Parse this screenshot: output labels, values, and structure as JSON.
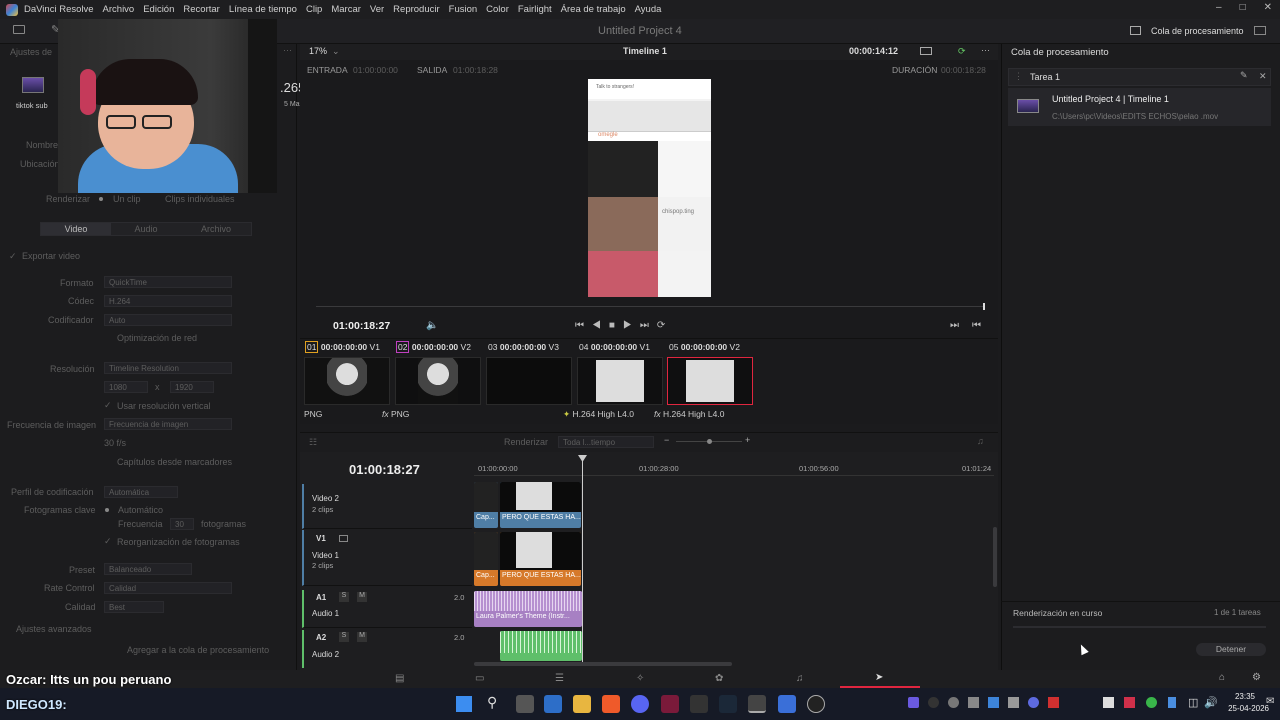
{
  "app": {
    "name": "DaVinci Resolve",
    "menu": [
      "Archivo",
      "Edición",
      "Recortar",
      "Línea de tiempo",
      "Clip",
      "Marcar",
      "Ver",
      "Reproducir",
      "Fusion",
      "Color",
      "Fairlight",
      "Área de trabajo",
      "Ayuda"
    ],
    "project_title": "Untitled Project 4",
    "timeline_name": "Timeline 1",
    "zoom": "17%",
    "timecode_top": "00:00:14:12",
    "render_queue_title": "Cola de procesamiento"
  },
  "left_panel": {
    "header": "Ajustes de",
    "preset_label": "tiktok sub",
    "codec_partial": ".265",
    "codec_partial2": "5 Mas",
    "nombre": "Nombre",
    "ubicacion": "Ubicación",
    "renderizar": "Renderizar",
    "un_clip": "Un clip",
    "clips_individuales": "Clips individuales",
    "tabs": [
      "Video",
      "Audio",
      "Archivo"
    ],
    "exportar_video": "Exportar video",
    "rows": [
      {
        "label": "Formato",
        "value": "QuickTime"
      },
      {
        "label": "Códec",
        "value": "H.264"
      },
      {
        "label": "Codificador",
        "value": "Auto"
      }
    ],
    "optimizacion": "Optimización de red",
    "resolucion_label": "Resolución",
    "resolucion_value": "Timeline Resolution",
    "res_w": "1080",
    "res_x": "x",
    "res_h": "1920",
    "usar_vertical": "Usar resolución vertical",
    "frecuencia_label": "Frecuencia de imagen",
    "frecuencia_value": "Frecuencia de imagen",
    "fps": "30 f/s",
    "capitulos": "Capítulos desde marcadores",
    "perfil_label": "Perfil de codificación",
    "perfil_value": "Automática",
    "fotogramas_label": "Fotogramas clave",
    "automatico": "Automático",
    "frecuencia": "Frecuencia",
    "frecuencia_num": "30",
    "fotogramas": "fotogramas",
    "reorganizacion": "Reorganización de fotogramas",
    "preset_row": {
      "label": "Preset",
      "value": "Balanceado"
    },
    "rate_row": {
      "label": "Rate Control",
      "value": "Calidad"
    },
    "calidad_row": {
      "label": "Calidad",
      "value": "Best"
    },
    "ajustes_avanzados": "Ajustes avanzados",
    "add_queue": "Agregar a la cola de procesamiento"
  },
  "viewer": {
    "entrada": "ENTRADA",
    "entrada_tc": "01:00:00:00",
    "salida": "SALIDA",
    "salida_tc": "01:00:18:28",
    "duracion": "DURACIÓN",
    "duracion_tc": "00:00:18:28",
    "current_tc": "01:00:18:27",
    "preview_text1": "Talk to strangers!",
    "preview_text2": "omegle",
    "preview_text3": "chispop.ting"
  },
  "clips": [
    {
      "num": "01",
      "tc": "00:00:00:00",
      "track": "V1",
      "label": "PNG",
      "fx": false
    },
    {
      "num": "02",
      "tc": "00:00:00:00",
      "track": "V2",
      "label": "PNG",
      "fx": true
    },
    {
      "num": "03",
      "tc": "00:00:00:00",
      "track": "V3",
      "label": "",
      "fx": false
    },
    {
      "num": "04",
      "tc": "00:00:00:00",
      "track": "V1",
      "label": "H.264 High L4.0",
      "fx": false
    },
    {
      "num": "05",
      "tc": "00:00:00:00",
      "track": "V2",
      "label": "H.264 High L4.0",
      "fx": true
    }
  ],
  "timeline": {
    "render_label": "Renderizar",
    "render_value": "Toda l...tiempo",
    "timecode": "01:00:18:27",
    "ruler": [
      "01:00:00:00",
      "01:00:28:00",
      "01:00:56:00",
      "01:01:24"
    ],
    "tracks": [
      {
        "id": "V2",
        "name": "Video 2",
        "sub": "2 clips"
      },
      {
        "id": "V1",
        "name": "Video 1",
        "sub": "2 clips"
      },
      {
        "id": "A1",
        "name": "Audio 1",
        "level": "2.0"
      },
      {
        "id": "A2",
        "name": "Audio 2",
        "level": "2.0"
      }
    ],
    "clip_cap": "Cap...",
    "clip_main": "PERO QUE ESTAS HA...",
    "audio_clip": "Laura Palmer's Theme (Instr..."
  },
  "queue": {
    "job": "Tarea 1",
    "item_title": "Untitled Project 4 | Timeline 1",
    "item_path": "C:\\Users\\pc\\Videos\\EDITS ECHOS\\pelao .mov",
    "status": "Renderización en curso",
    "count": "1 de 1 tareas",
    "stop": "Detener"
  },
  "overlay": {
    "line1": "Ozcar: Itts un pou peruano",
    "line2": "DIEGO19:"
  },
  "taskbar": {
    "time": "23:35",
    "date": "25-04-2026"
  },
  "colors": {
    "accent_red": "#e0263f",
    "clip_blue": "#4f7ea5",
    "clip_orange": "#d6792a",
    "audio_purple": "#a780c3",
    "audio_green": "#5fbf6a"
  }
}
